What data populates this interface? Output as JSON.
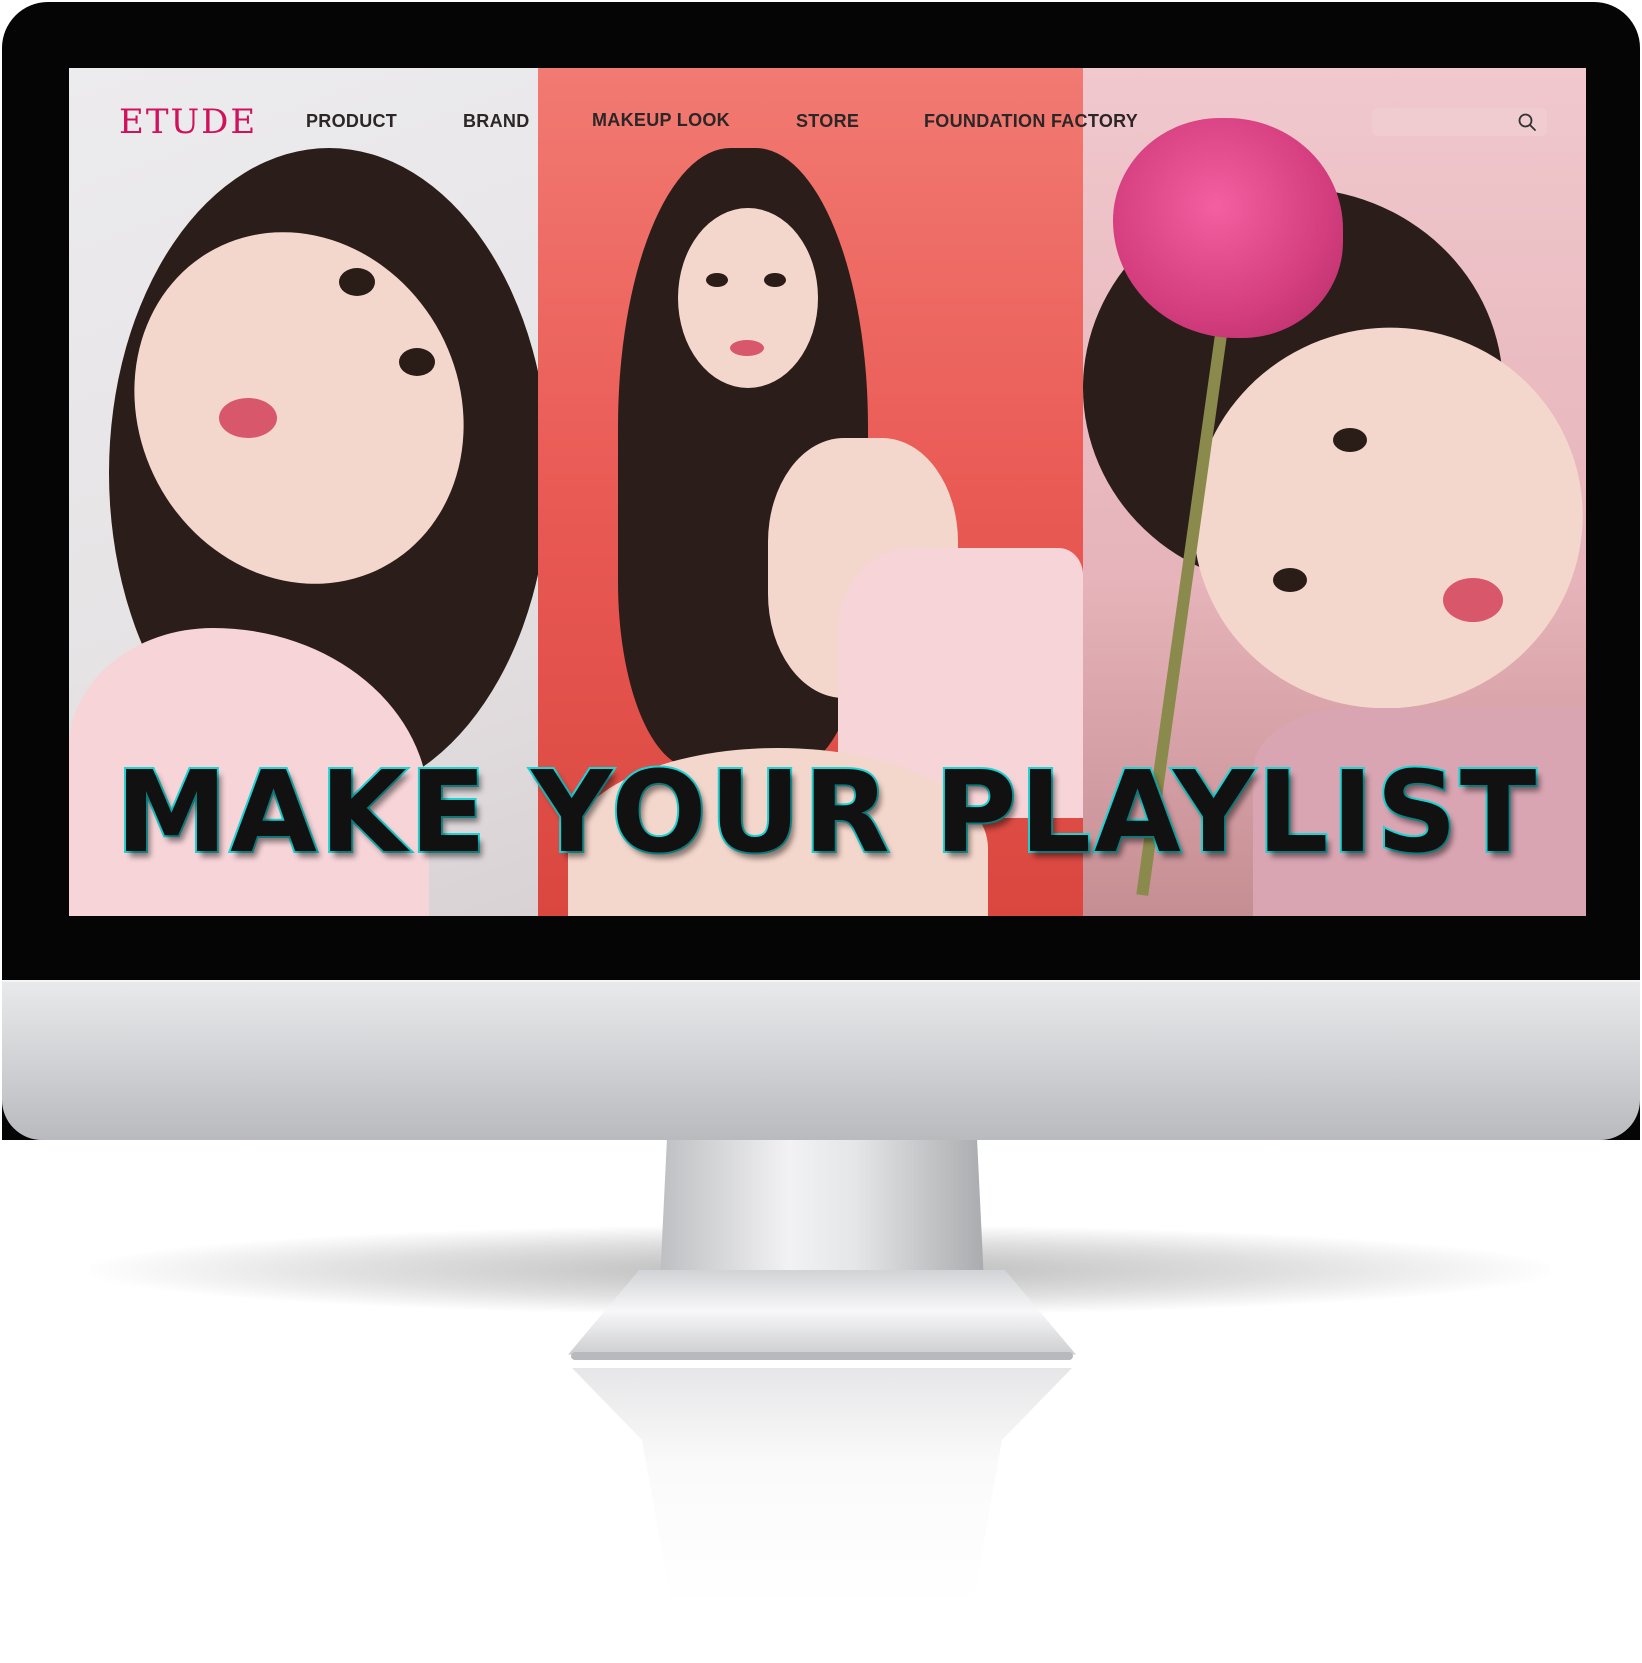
{
  "brand": {
    "logo_text": "ETUDE",
    "accent_color": "#d0115c"
  },
  "nav": {
    "items": [
      {
        "label": "PRODUCT"
      },
      {
        "label": "BRAND"
      },
      {
        "label": "MAKEUP LOOK"
      },
      {
        "label": "STORE"
      },
      {
        "label": "FOUNDATION FACTORY"
      }
    ],
    "search": {
      "placeholder": "",
      "icon": "search-icon"
    }
  },
  "hero": {
    "headline": "MAKE YOUR PLAYLIST",
    "headline_outline_color": "#1dd4d4",
    "panel_colors": [
      "#e9e6e8",
      "#ec5f58",
      "#ebbcc2"
    ]
  }
}
